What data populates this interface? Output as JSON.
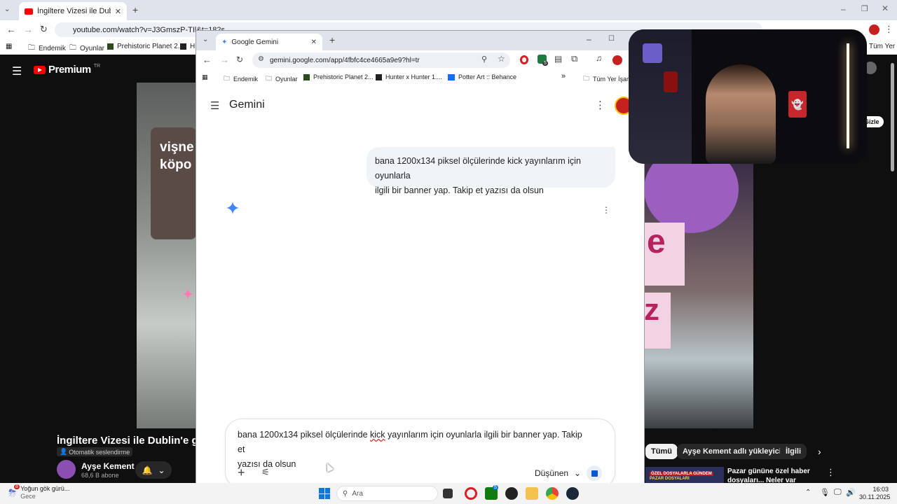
{
  "bg_browser": {
    "tab_title": "İngiltere Vizesi ile Dublin'e geld",
    "url": "youtube.com/watch?v=J3GmszP-TIl&t=182s",
    "bookmarks": [
      "Endemik",
      "Oyunlar",
      "Prehistoric Planet 2...",
      "Hu"
    ],
    "bookmarks_right": "Tüm Yer İşaretleri"
  },
  "youtube": {
    "logo": "Premium",
    "logo_region": "TR",
    "video_title": "İngiltere Vizesi ile Dublin'e geldim",
    "auto_dub": "Otomatik seslendirme",
    "channel_name": "Ayşe Kement",
    "subscribers": "68,6 B abone",
    "overlay_text_line1": "vişne",
    "overlay_text_line2": "köpo",
    "hide_label": "Gizle",
    "chips": [
      "Tümü",
      "Ayşe Kement adlı yükleyiciden",
      "İlgili"
    ],
    "rec_thumb_label": "ÖZEL DOSYALARLA GÜNDEM",
    "rec_thumb_sub": "PAZAR DOSYALARI",
    "rec_title_line1": "Pazar gününe özel haber",
    "rec_title_line2": "dosyaları... Neler var neler!!!",
    "notif_count": "8"
  },
  "fg_browser": {
    "tab_title": "Google Gemini",
    "url": "gemini.google.com/app/4fbfc4ce4665a9e9?hl=tr",
    "bookmarks": [
      "Endemik",
      "Oyunlar",
      "Prehistoric Planet 2...",
      "Hunter x Hunter 1....",
      "Potter Art :: Behance"
    ],
    "bookmarks_more": "»",
    "bookmarks_right": "Tüm Yer İşaretleri",
    "ext_badge": "5"
  },
  "gemini": {
    "brand": "Gemini",
    "user_message_line1": "bana 1200x134 piksel ölçülerinde kick yayınlarım için oyunlarla",
    "user_message_line2": "ilgili bir banner yap. Takip et yazısı da olsun",
    "prompt_line1_before": "bana 1200x134 piksel ölçülerinde ",
    "prompt_misspelled": "kick",
    "prompt_line1_after": " yayınlarım için oyunlarla ilgili bir banner yap. Takip et",
    "prompt_line2": "yazısı da olsun",
    "model_label": "Düşünen"
  },
  "taskbar": {
    "weather_title": "Yoğun gök gürü...",
    "weather_sub": "Gece",
    "weather_badge": "8",
    "search_placeholder": "Ara",
    "time": "16:03",
    "date": "30.11.2025",
    "xbox_badge": "5"
  },
  "colors": {
    "gemini_star": "#4285f4",
    "youtube_red": "#ff0000",
    "stop_button": "#0b57d0"
  }
}
